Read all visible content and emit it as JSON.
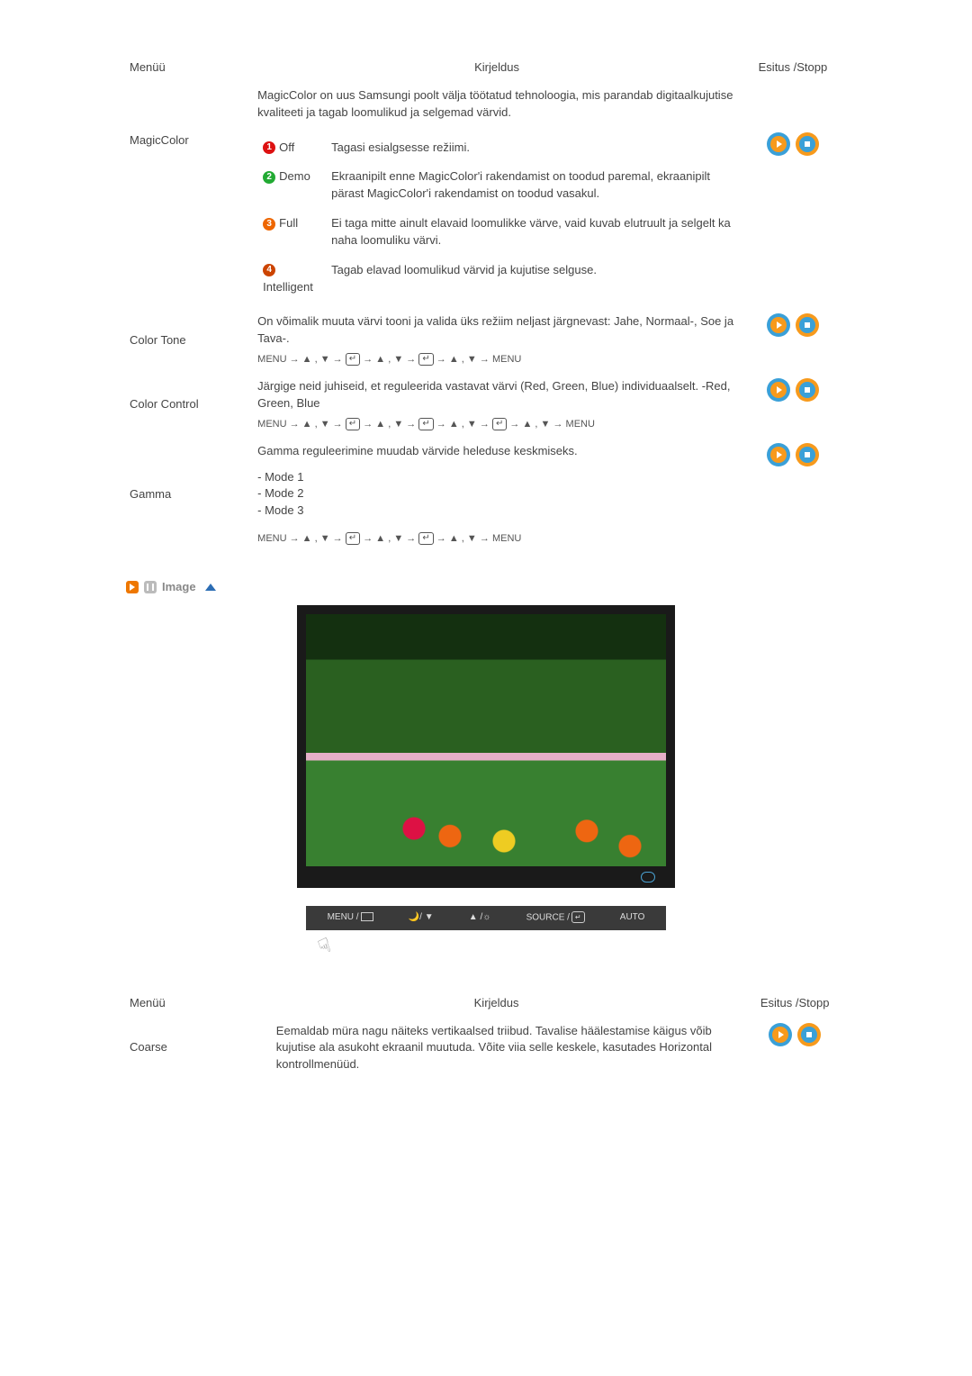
{
  "headers": {
    "menu": "Menüü",
    "desc": "Kirjeldus",
    "play": "Esitus /Stopp"
  },
  "magicColor": {
    "intro": "MagicColor on uus Samsungi poolt välja töötatud tehnoloogia, mis parandab digitaalkujutise kvaliteeti ja tagab loomulikud ja selgemad värvid.",
    "title": "MagicColor",
    "options": {
      "offLabel": "Off",
      "offDesc": "Tagasi esialgsesse režiimi.",
      "demoLabel": "Demo",
      "demoDesc": "Ekraanipilt enne MagicColor'i rakendamist on toodud paremal, ekraanipilt pärast MagicColor'i rakendamist on toodud vasakul.",
      "fullLabel": "Full",
      "fullDesc": "Ei taga mitte ainult elavaid loomulikke värve, vaid kuvab elutruult ja selgelt ka naha loomuliku värvi.",
      "intelligentLabel": "Intelligent",
      "intelligentDesc": "Tagab elavad loomulikud värvid ja kujutise selguse."
    }
  },
  "colorTone": {
    "title": "Color Tone",
    "desc": "On võimalik muuta värvi tooni ja valida üks režiim neljast järgnevast: Jahe, Normaal-, Soe ja Tava-."
  },
  "colorControl": {
    "title": "Color Control",
    "desc": "Järgige neid juhiseid, et reguleerida vastavat värvi (Red, Green, Blue) individuaalselt. -Red, Green, Blue"
  },
  "gamma": {
    "title": "Gamma",
    "desc": "Gamma reguleerimine muudab värvide heleduse keskmiseks.",
    "modes": {
      "m1": "- Mode 1",
      "m2": "- Mode 2",
      "m3": "- Mode 3"
    }
  },
  "nav": {
    "menu": "MENU",
    "arrow": "▲ , ▼",
    "sep": " → "
  },
  "imageSection": {
    "heading": "Image",
    "bar": {
      "menu": "MENU /",
      "bright": "▲/ ▼",
      "sun": "▲ /☼",
      "source": "SOURCE /",
      "auto": "AUTO"
    }
  },
  "coarse": {
    "title": "Coarse",
    "desc": "Eemaldab müra nagu näiteks vertikaalsed triibud. Tavalise häälestamise käigus võib kujutise ala asukoht ekraanil muutuda. Võite viia selle keskele, kasutades Horizontal kontrollmenüüd."
  }
}
